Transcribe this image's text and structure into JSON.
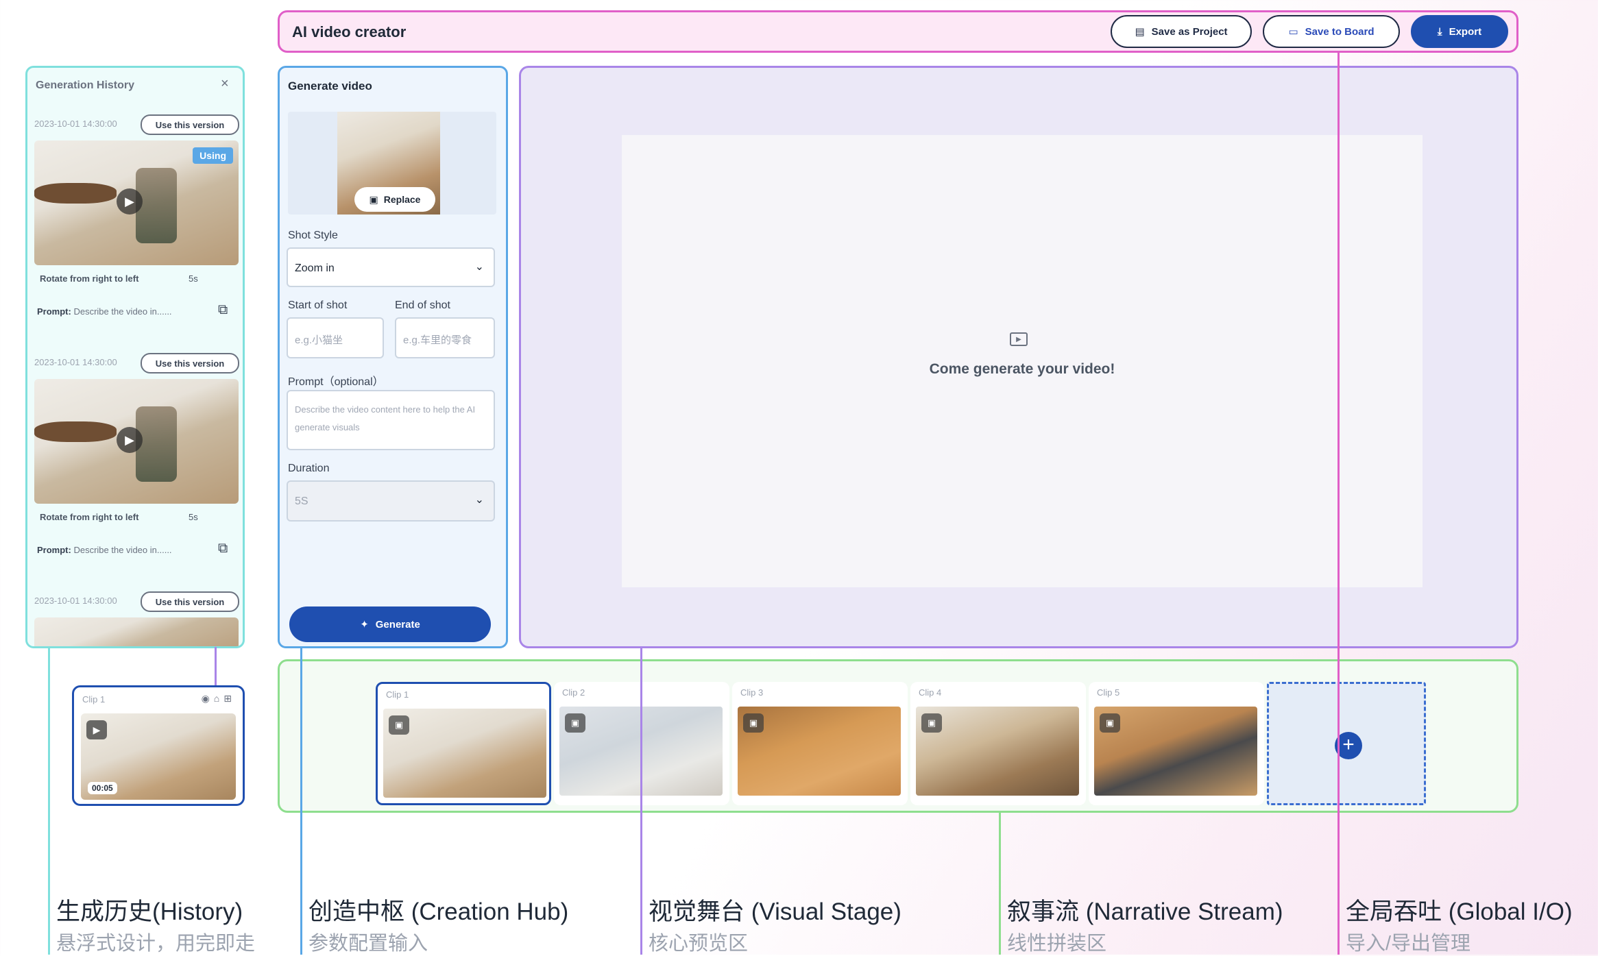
{
  "topbar": {
    "title": "AI video creator",
    "save_project": "Save as Project",
    "save_board": "Save to Board",
    "export": "Export"
  },
  "history": {
    "title": "Generation History",
    "close": "×",
    "entries": [
      {
        "timestamp": "2023-10-01 14:30:00",
        "use_label": "Use this version",
        "using": "Using",
        "description": "Rotate from right to left",
        "duration": "5s",
        "prompt_label": "Prompt:",
        "prompt": "Describe the video in......"
      },
      {
        "timestamp": "2023-10-01 14:30:00",
        "use_label": "Use this version",
        "description": "Rotate from right to left",
        "duration": "5s",
        "prompt_label": "Prompt:",
        "prompt": "Describe the video in......"
      },
      {
        "timestamp": "2023-10-01 14:30:00",
        "use_label": "Use this version"
      }
    ]
  },
  "float_clip": {
    "label": "Clip 1",
    "time": "00:05"
  },
  "hub": {
    "title": "Generate video",
    "replace": "Replace",
    "shot_style_label": "Shot Style",
    "shot_style_value": "Zoom in",
    "start_label": "Start of shot",
    "end_label": "End of shot",
    "start_placeholder": "e.g.小猫坐",
    "end_placeholder": "e.g.车里的零食",
    "prompt_label": "Prompt（optional）",
    "prompt_placeholder": "Describe the video content here to help the AI generate visuals",
    "duration_label": "Duration",
    "duration_value": "5S",
    "generate": "Generate"
  },
  "stage": {
    "message": "Come generate your video!"
  },
  "stream": {
    "clips": [
      "Clip 1",
      "Clip 2",
      "Clip 3",
      "Clip 4",
      "Clip 5"
    ],
    "add": "+"
  },
  "captions": [
    {
      "title": "生成历史(History)",
      "sub": "悬浮式设计，用完即走"
    },
    {
      "title": "创造中枢 (Creation Hub)",
      "sub": "参数配置输入"
    },
    {
      "title": "视觉舞台 (Visual Stage)",
      "sub": "核心预览区"
    },
    {
      "title": "叙事流 (Narrative Stream)",
      "sub": "线性拼装区"
    },
    {
      "title": "全局吞吐 (Global I/O)",
      "sub": "导入/导出管理"
    }
  ],
  "colors": {
    "history": "#7fe0dd",
    "hub": "#5aa7e6",
    "stage": "#a985e8",
    "stream": "#8ede8e",
    "io": "#e05fc8",
    "primary": "#1f4fb0"
  }
}
